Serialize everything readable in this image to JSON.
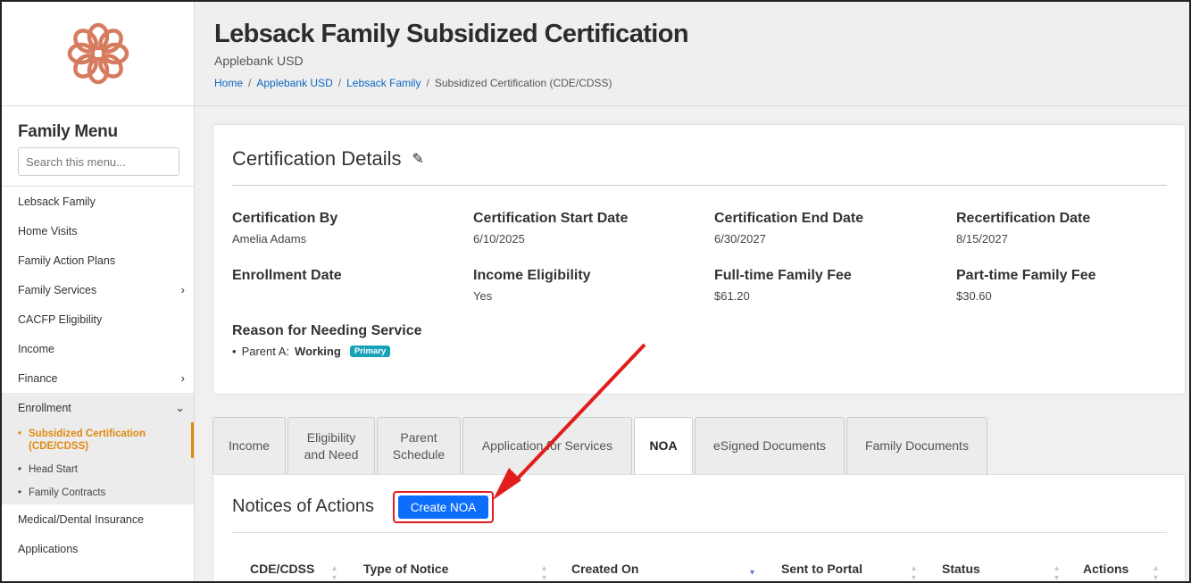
{
  "header": {
    "title": "Lebsack Family Subsidized Certification",
    "subtitle": "Applebank USD",
    "breadcrumb": [
      "Home",
      "Applebank USD",
      "Lebsack Family",
      "Subsidized Certification (CDE/CDSS)"
    ]
  },
  "sidebar": {
    "title": "Family Menu",
    "search_placeholder": "Search this menu...",
    "items": [
      {
        "label": "Lebsack Family"
      },
      {
        "label": "Home Visits"
      },
      {
        "label": "Family Action Plans"
      },
      {
        "label": "Family Services"
      },
      {
        "label": "CACFP Eligibility"
      },
      {
        "label": "Income"
      },
      {
        "label": "Finance"
      },
      {
        "label": "Enrollment"
      }
    ],
    "enrollment_sub": [
      {
        "label": "Subsidized Certification (CDE/CDSS)"
      },
      {
        "label": "Head Start"
      },
      {
        "label": "Family Contracts"
      }
    ],
    "after": [
      {
        "label": "Medical/Dental Insurance"
      },
      {
        "label": "Applications"
      }
    ]
  },
  "details": {
    "title": "Certification Details",
    "fields": [
      {
        "label": "Certification By",
        "value": "Amelia Adams"
      },
      {
        "label": "Certification Start Date",
        "value": "6/10/2025"
      },
      {
        "label": "Certification End Date",
        "value": "6/30/2027"
      },
      {
        "label": "Recertification Date",
        "value": "8/15/2027"
      },
      {
        "label": "Enrollment Date",
        "value": ""
      },
      {
        "label": "Income Eligibility",
        "value": "Yes"
      },
      {
        "label": "Full-time Family Fee",
        "value": "$61.20"
      },
      {
        "label": "Part-time Family Fee",
        "value": "$30.60"
      }
    ],
    "reason_label": "Reason for Needing Service",
    "reason_parent": "Parent A:",
    "reason_value": "Working",
    "reason_badge": "Primary"
  },
  "tabs": [
    {
      "label": "Income"
    },
    {
      "label": "Eligibility and Need"
    },
    {
      "label": "Parent Schedule"
    },
    {
      "label": "Application for Services"
    },
    {
      "label": "NOA"
    },
    {
      "label": "eSigned Documents"
    },
    {
      "label": "Family Documents"
    }
  ],
  "panel": {
    "title": "Notices of Actions",
    "create_label": "Create NOA",
    "columns": [
      "CDE/CDSS",
      "Type of Notice",
      "Created On",
      "Sent to Portal",
      "Status",
      "Actions"
    ]
  },
  "colors": {
    "accent": "#e0890f",
    "primary_button": "#0d6efd",
    "highlight": "#e21d1d",
    "badge": "#17a2b8",
    "logo": "#d77b5f"
  }
}
